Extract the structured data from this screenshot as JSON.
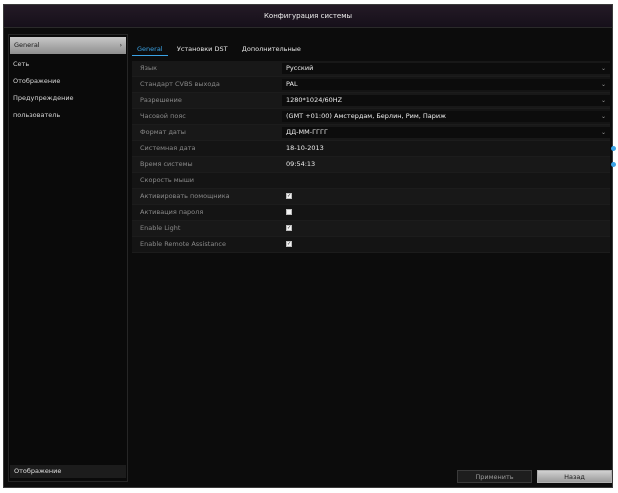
{
  "window": {
    "title": "Конфигурация системы"
  },
  "sidebar": {
    "items": [
      {
        "label": "General",
        "arrow": "›",
        "active": true
      },
      {
        "label": "Сеть"
      },
      {
        "label": "Отображение"
      },
      {
        "label": "Предупреждение"
      },
      {
        "label": "пользователь"
      }
    ],
    "bottom_label": "Отображение"
  },
  "tabs": [
    {
      "label": "General",
      "active": true
    },
    {
      "label": "Установки DST"
    },
    {
      "label": "Дополнительные"
    }
  ],
  "form": {
    "rows": [
      {
        "label": "Язык",
        "value": "Русский",
        "kind": "dropdown"
      },
      {
        "label": "Стандарт CVBS выхода",
        "value": "PAL",
        "kind": "dropdown"
      },
      {
        "label": "Разрешение",
        "value": "1280*1024/60HZ",
        "kind": "dropdown"
      },
      {
        "label": "Часовой пояс",
        "value": "(GMT +01:00) Амстердам, Берлин, Рим, Париж",
        "kind": "dropdown"
      },
      {
        "label": "Формат даты",
        "value": "ДД-ММ-ГГГГ",
        "kind": "dropdown"
      },
      {
        "label": "Системная дата",
        "value": "18-10-2013",
        "kind": "date"
      },
      {
        "label": "Время системы",
        "value": "09:54:13",
        "kind": "date"
      },
      {
        "label": "Скорость мыши",
        "value": "",
        "kind": "slider"
      },
      {
        "label": "Активировать помощника",
        "checked": true,
        "kind": "checkbox"
      },
      {
        "label": "Активация пароля",
        "checked": false,
        "kind": "checkbox"
      },
      {
        "label": "Enable Light",
        "checked": true,
        "kind": "checkbox"
      },
      {
        "label": "Enable Remote Assistance",
        "checked": true,
        "kind": "checkbox"
      }
    ]
  },
  "buttons": {
    "apply": "Применить",
    "back": "Назад"
  },
  "colors": {
    "accent": "#3aa3e6",
    "background": "#0c0c0c"
  },
  "icons": {
    "dropdown": "chevron-down-icon",
    "date": "calendar-dot-icon",
    "check": "check-icon"
  }
}
